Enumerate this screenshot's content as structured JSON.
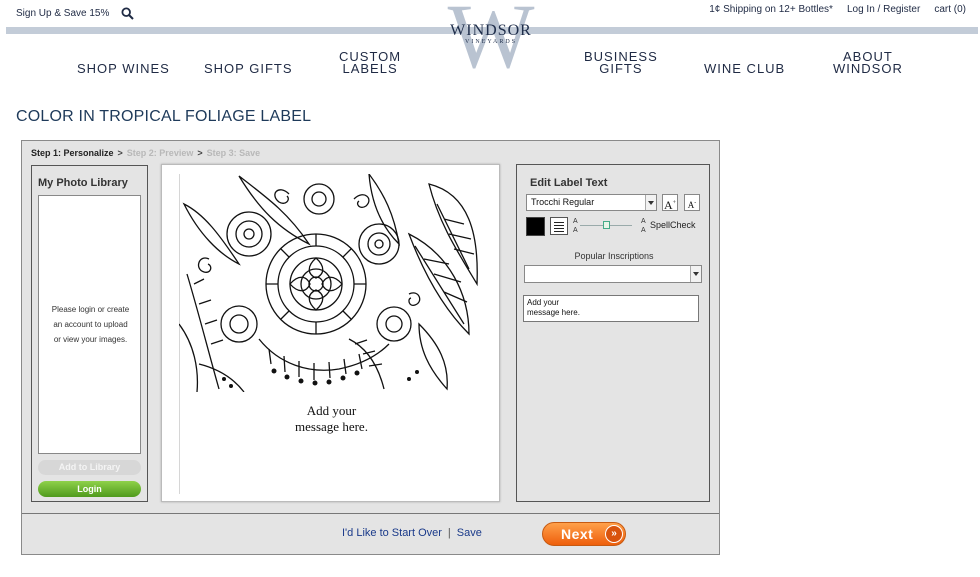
{
  "header": {
    "promo": "Sign Up & Save 15%",
    "shipping": "1¢ Shipping on 12+ Bottles*",
    "login_register": "Log In / Register",
    "cart": "cart (0)",
    "logo_name": "WINDSOR",
    "logo_sub": "VINEYARDS",
    "logo_letter": "W"
  },
  "nav": {
    "shop_wines": "SHOP WINES",
    "shop_gifts": "SHOP GIFTS",
    "custom_1": "CUSTOM",
    "custom_2": "LABELS",
    "business_1": "BUSINESS",
    "business_2": "GIFTS",
    "wine_club": "WINE CLUB",
    "about_1": "ABOUT",
    "about_2": "WINDSOR"
  },
  "page": {
    "title": "COLOR IN TROPICAL FOLIAGE LABEL"
  },
  "steps": {
    "step1": "Step 1: Personalize",
    "step2": "Step 2: Preview",
    "step3": "Step 3: Save",
    "arrow": ">"
  },
  "library": {
    "title": "My Photo Library",
    "msg_1": "Please login or create",
    "msg_2": "an account to upload",
    "msg_3": "or view your images.",
    "add_button": "Add to Library",
    "login_button": "Login"
  },
  "canvas": {
    "line_1": "Add your",
    "line_2": "message here."
  },
  "text_panel": {
    "title": "Edit Label Text",
    "font": "Trocchi Regular",
    "size_up": "A",
    "size_down": "A",
    "slider_letter": "A",
    "spellcheck": "SpellCheck",
    "inscriptions_label": "Popular Inscriptions",
    "inscription_value": "",
    "message_line_1": "Add your",
    "message_line_2": "message here.",
    "text_color": "#000000"
  },
  "footer": {
    "start_over": "I'd Like to Start Over",
    "separator": "|",
    "save": "Save",
    "next": "Next",
    "next_icon": "»"
  }
}
